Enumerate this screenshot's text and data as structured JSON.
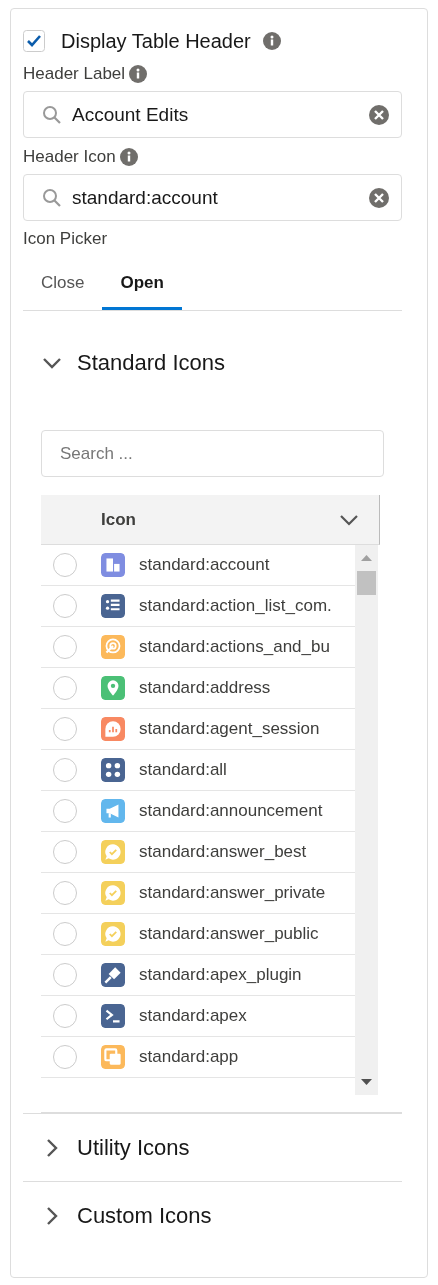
{
  "display_header": {
    "label": "Display Table Header",
    "checked": true
  },
  "header_label": {
    "label": "Header Label",
    "value": "Account Edits"
  },
  "header_icon": {
    "label": "Header Icon",
    "value": "standard:account"
  },
  "icon_picker": {
    "label": "Icon Picker"
  },
  "tabs": [
    {
      "label": "Close",
      "selected": false
    },
    {
      "label": "Open",
      "selected": true
    }
  ],
  "sections": [
    {
      "title": "Standard Icons",
      "expanded": true,
      "search": {
        "placeholder": "Search ..."
      },
      "table": {
        "columns": [
          "Icon"
        ],
        "rows": [
          {
            "name": "standard:account",
            "kind": "building",
            "color": "#7f8de1",
            "selected": false
          },
          {
            "name": "standard:action_list_com.",
            "kind": "list",
            "color": "#4a6592",
            "selected": false
          },
          {
            "name": "standard:actions_and_bu",
            "kind": "target",
            "color": "#fcb95b",
            "selected": false
          },
          {
            "name": "standard:address",
            "kind": "pin",
            "color": "#4bc076",
            "selected": false
          },
          {
            "name": "standard:agent_session",
            "kind": "chart",
            "color": "#f88962",
            "selected": false
          },
          {
            "name": "standard:all",
            "kind": "grid",
            "color": "#4a6592",
            "selected": false
          },
          {
            "name": "standard:announcement",
            "kind": "megaphone",
            "color": "#62b7ed",
            "selected": false
          },
          {
            "name": "standard:answer_best",
            "kind": "chat",
            "color": "#f4d05b",
            "selected": false
          },
          {
            "name": "standard:answer_private",
            "kind": "chat",
            "color": "#f4d05b",
            "selected": false
          },
          {
            "name": "standard:answer_public",
            "kind": "chat",
            "color": "#f4d05b",
            "selected": false
          },
          {
            "name": "standard:apex_plugin",
            "kind": "plug",
            "color": "#4a6592",
            "selected": false
          },
          {
            "name": "standard:apex",
            "kind": "terminal",
            "color": "#4a6592",
            "selected": false
          },
          {
            "name": "standard:app",
            "kind": "windows",
            "color": "#fcb95b",
            "selected": false
          }
        ]
      }
    },
    {
      "title": "Utility Icons",
      "expanded": false
    },
    {
      "title": "Custom Icons",
      "expanded": false
    }
  ]
}
